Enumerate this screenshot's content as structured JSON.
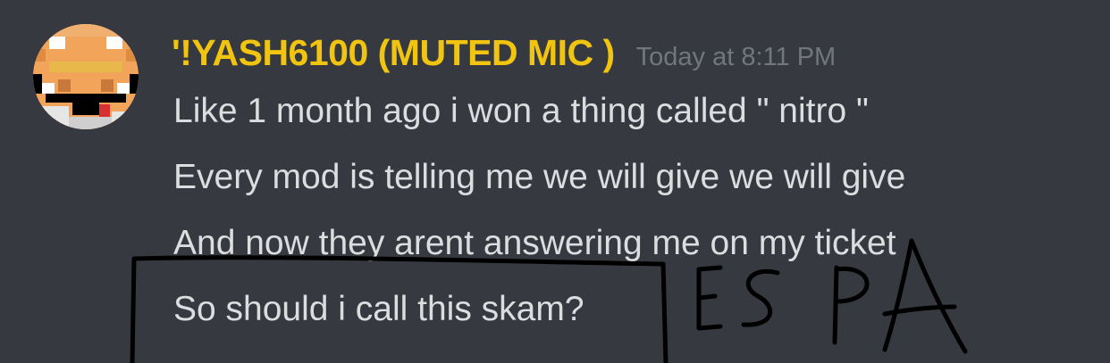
{
  "message": {
    "author": "'!YASH6100 (MUTED MIC )",
    "timestamp": "Today at 8:11 PM",
    "lines": [
      "Like 1 month ago i won a thing called \" nitro \"",
      "Every mod is telling me we will give we will give",
      "And now they arent answering me on my ticket",
      "So should i call this skam?"
    ]
  },
  "annotation": {
    "handwritten_text": "ESPA",
    "ink_color": "#000000"
  },
  "colors": {
    "background": "#36393f",
    "username": "#f1c40f",
    "timestamp": "#72767d",
    "message_text": "#dcddde"
  },
  "icons": {
    "avatar": "pixel-face-avatar"
  }
}
